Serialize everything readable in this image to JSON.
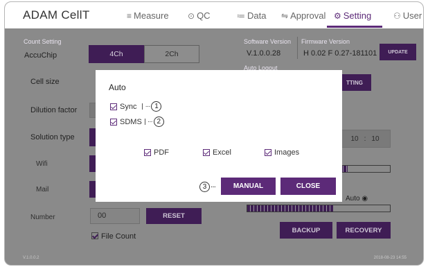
{
  "app": {
    "title": "ADAM CellT"
  },
  "nav": [
    {
      "icon": "≡",
      "label": "Measure"
    },
    {
      "icon": "⊙",
      "label": "QC"
    },
    {
      "icon": "≔",
      "label": "Data"
    },
    {
      "icon": "⇋",
      "label": "Approval"
    },
    {
      "icon": "⚙",
      "label": "Setting"
    },
    {
      "icon": "⚇",
      "label": "User"
    }
  ],
  "settings": {
    "count_setting": "Count Setting",
    "accuchip": "AccuChip",
    "seg_4ch": "4Ch",
    "seg_2ch": "2Ch",
    "cell_size": "Cell size",
    "dilution_factor": "Dilution factor",
    "solution_type": "Solution type",
    "wifi": "Wifi",
    "mail": "Mail",
    "number": "Number",
    "number_value": "00",
    "reset": "RESET",
    "file_count": "File Count",
    "software_version_label": "Software Version",
    "software_version": "V.1.0.0.28",
    "firmware_version_label": "Firmware Version",
    "firmware_version": "H 0.02 F 0.27-181101",
    "update": "UPDATE",
    "auto_logout": "Auto Logout",
    "setting_btn": "TTING",
    "time_hour": "10",
    "time_sep": ":",
    "time_min": "10",
    "auto_label": "Auto",
    "backup": "BACKUP",
    "recovery": "RECOVERY",
    "bar1_fill": 0.15,
    "bar2_fill": 0.6
  },
  "footer": {
    "version": "V.1.0.0.2",
    "timestamp": "2018-08-23 14:55"
  },
  "modal": {
    "title": "Auto",
    "sync": "Sync",
    "sdms": "SDMS",
    "pdf": "PDF",
    "excel": "Excel",
    "images": "Images",
    "callout_dots": "···",
    "callout1": "1",
    "callout2": "2",
    "callout3": "3",
    "manual": "MANUAL",
    "close": "CLOSE"
  }
}
